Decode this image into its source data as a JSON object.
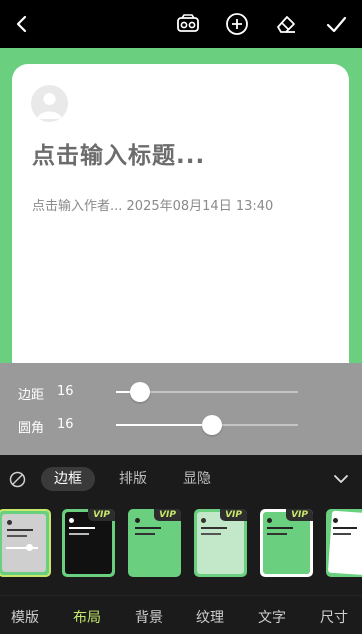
{
  "topbar": {
    "icons": [
      "back-arrow-icon",
      "vr-glasses-icon",
      "add-circle-icon",
      "eraser-icon",
      "checkmark-icon"
    ]
  },
  "card": {
    "title": "点击输入标题...",
    "meta": "点击输入作者... 2025年08月14日 13:40"
  },
  "sliders": [
    {
      "label": "边距",
      "value": "16",
      "level": 0.13
    },
    {
      "label": "圆角",
      "value": "16",
      "level": 0.53
    }
  ],
  "segments": {
    "items": [
      "边框",
      "排版",
      "显隐"
    ],
    "active_index": 0
  },
  "thumbnails": {
    "vip_label": "VIP",
    "count": 6
  },
  "bottom_nav": {
    "items": [
      "模版",
      "布局",
      "背景",
      "纹理",
      "文字",
      "尺寸"
    ],
    "active_index": 1
  },
  "colors": {
    "accent": "#c7e96b",
    "stage_green": "#6ad07f"
  }
}
